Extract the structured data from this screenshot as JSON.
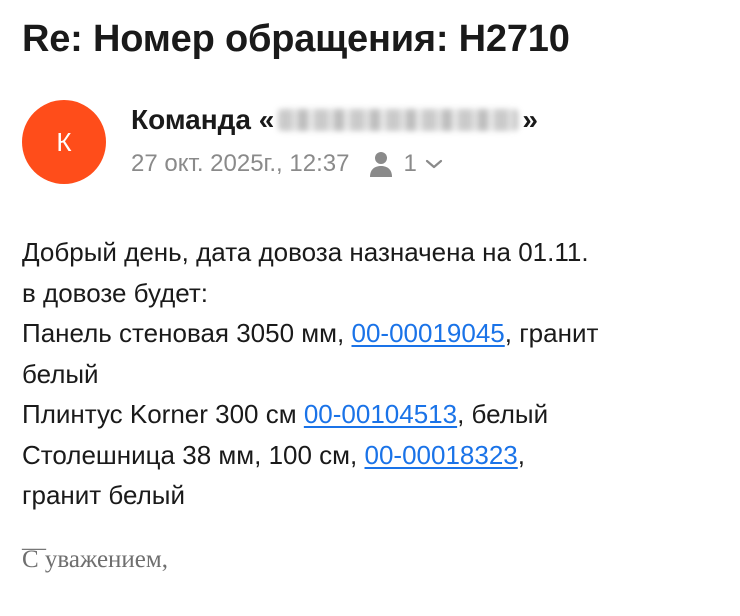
{
  "subject": "Re: Номер обращения: Н2710",
  "sender": {
    "avatar_letter": "К",
    "name_prefix": "Команда «",
    "name_suffix": "»",
    "avatar_color": "#ff4d1a"
  },
  "meta": {
    "date": "27 окт. 2025г., 12:37",
    "recipients_count": "1",
    "icon": "person-icon"
  },
  "body": {
    "line1": "Добрый день, дата довоза назначена на 01.11.",
    "line2": "в довозе будет:",
    "item1_text": "Панель стеновая 3050 мм, ",
    "item1_link": "00-00019045",
    "item1_after": ", гранит",
    "item1_cont": "белый",
    "item2_text": "Плинтус Korner 300 см ",
    "item2_link": "00-00104513",
    "item2_after": ", белый",
    "item3_text": "Столешница 38 мм, 100 см, ",
    "item3_link": "00-00018323",
    "item3_after": ",",
    "item3_cont": "гранит белый"
  },
  "signature": {
    "dash": "—",
    "text": "С уважением,"
  },
  "colors": {
    "link": "#1a73e8",
    "meta_text": "#8a8a8a"
  }
}
